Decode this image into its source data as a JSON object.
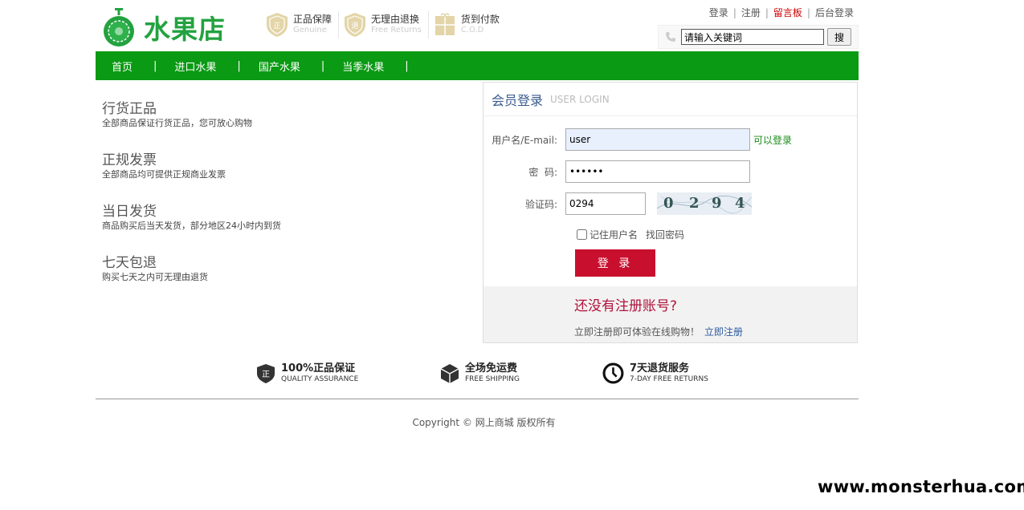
{
  "brand": {
    "name": "水果店",
    "color": "#23a23f"
  },
  "promises": [
    {
      "title": "正品保障",
      "sub": "Genuine",
      "icon": "genuine-shield-icon"
    },
    {
      "title": "无理由退换",
      "sub": "Free Returns",
      "icon": "returns-shield-icon"
    },
    {
      "title": "货到付款",
      "sub": "C.O.D",
      "icon": "cod-box-icon"
    }
  ],
  "toplinks": {
    "login": "登录",
    "register": "注册",
    "guestbook": "留言板",
    "admin": "后台登录"
  },
  "search": {
    "value": "请输入关键词",
    "button": "搜"
  },
  "nav": {
    "items": [
      "首页",
      "进口水果",
      "国产水果",
      "当季水果"
    ],
    "sep": "|",
    "color": "#0a9a13"
  },
  "features": [
    {
      "title": "行货正品",
      "desc": "全部商品保证行货正品，您可放心购物"
    },
    {
      "title": "正规发票",
      "desc": "全部商品均可提供正规商业发票"
    },
    {
      "title": "当日发货",
      "desc": "商品购买后当天发货，部分地区24小时内到货"
    },
    {
      "title": "七天包退",
      "desc": "购买七天之内可无理由退货"
    }
  ],
  "login": {
    "title": "会员登录",
    "subtitle": "USER LOGIN",
    "username_label": "用户名/E-mail:",
    "username_value": "user",
    "username_ok": "可以登录",
    "password_label": "密  码:",
    "password_value": "••••••",
    "captcha_label": "验证码:",
    "captcha_value": "0294",
    "captcha_chars": [
      "0",
      "2",
      "9",
      "4"
    ],
    "remember_label": "记住用户名",
    "forgot_label": "找回密码",
    "submit_label": "登 录",
    "reg_title": "还没有注册账号?",
    "reg_tip": "立即注册即可体验在线购物！",
    "reg_link": "立即注册"
  },
  "services": [
    {
      "title": "100%正品保证",
      "sub": "QUALITY ASSURANCE",
      "icon": "quality-shield-icon"
    },
    {
      "title": "全场免运费",
      "sub": "FREE SHIPPING",
      "icon": "shipping-box-icon"
    },
    {
      "title": "7天退货服务",
      "sub": "7-DAY FREE RETURNS",
      "icon": "clock-icon"
    }
  ],
  "footer": {
    "copyright": "Copyright © 网上商城 版权所有"
  },
  "watermark": "www.monsterhua.com"
}
